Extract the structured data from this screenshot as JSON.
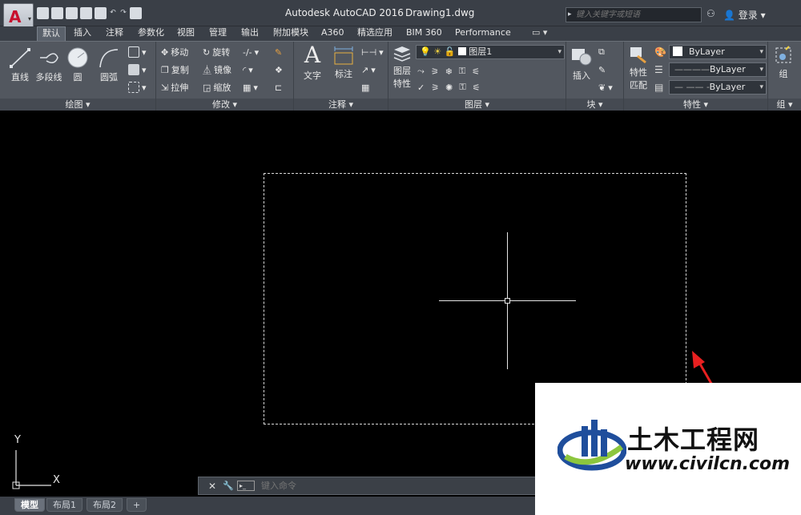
{
  "titlebar": {
    "app_name": "Autodesk AutoCAD 2016",
    "document": "Drawing1.dwg",
    "search_placeholder": "键入关键字或短语",
    "login_label": "登录"
  },
  "tabs": [
    "默认",
    "插入",
    "注释",
    "参数化",
    "视图",
    "管理",
    "输出",
    "附加模块",
    "A360",
    "精选应用",
    "BIM 360",
    "Performance"
  ],
  "ribbon": {
    "draw": {
      "footer": "绘图 ▾",
      "line": "直线",
      "polyline": "多段线",
      "circle": "圆",
      "arc": "圆弧"
    },
    "modify": {
      "footer": "修改 ▾",
      "move": "移动",
      "rotate": "旋转",
      "copy": "复制",
      "mirror": "镜像",
      "stretch": "拉伸",
      "scale": "缩放"
    },
    "annotation": {
      "footer": "注释 ▾",
      "text": "文字",
      "dimension": "标注"
    },
    "layers": {
      "footer": "图层 ▾",
      "layer_props": "图层",
      "layer_props2": "特性",
      "current_layer": "图层1"
    },
    "block": {
      "footer": "块 ▾",
      "insert": "插入"
    },
    "properties": {
      "footer": "特性 ▾",
      "match": "特性",
      "match2": "匹配",
      "color": "ByLayer",
      "linetype": "ByLayer",
      "lineweight": "ByLayer"
    },
    "groups": {
      "footer": "组 ▾",
      "group": "组"
    }
  },
  "ucs": {
    "x": "X",
    "y": "Y"
  },
  "command": {
    "placeholder": "键入命令"
  },
  "layout_tabs": [
    "模型",
    "布局1",
    "布局2",
    "+"
  ],
  "watermark": {
    "name": "土木工程网",
    "url": "www.civilcn.com"
  }
}
